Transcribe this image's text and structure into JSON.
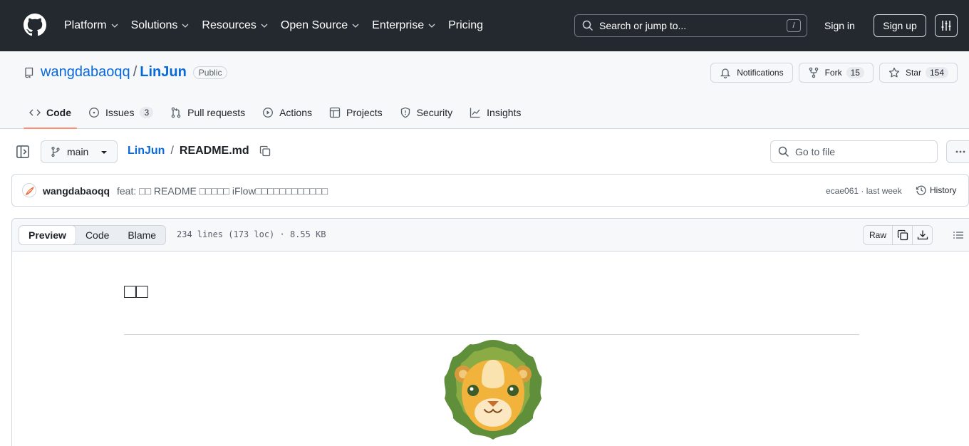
{
  "header": {
    "nav": [
      {
        "label": "Platform",
        "dropdown": true
      },
      {
        "label": "Solutions",
        "dropdown": true
      },
      {
        "label": "Resources",
        "dropdown": true
      },
      {
        "label": "Open Source",
        "dropdown": true
      },
      {
        "label": "Enterprise",
        "dropdown": true
      },
      {
        "label": "Pricing",
        "dropdown": false
      }
    ],
    "search_placeholder": "Search or jump to...",
    "search_shortcut": "/",
    "sign_in": "Sign in",
    "sign_up": "Sign up"
  },
  "repo": {
    "owner": "wangdabaoqq",
    "separator": "/",
    "name": "LinJun",
    "visibility": "Public",
    "notifications_label": "Notifications",
    "fork_label": "Fork",
    "fork_count": "15",
    "star_label": "Star",
    "star_count": "154",
    "tabs": [
      {
        "label": "Code",
        "active": true,
        "icon": "code-icon"
      },
      {
        "label": "Issues",
        "count": "3",
        "icon": "issue-icon"
      },
      {
        "label": "Pull requests",
        "icon": "pull-request-icon"
      },
      {
        "label": "Actions",
        "icon": "play-icon"
      },
      {
        "label": "Projects",
        "icon": "table-icon"
      },
      {
        "label": "Security",
        "icon": "shield-icon"
      },
      {
        "label": "Insights",
        "icon": "graph-icon"
      }
    ]
  },
  "file_nav": {
    "branch": "main",
    "crumb_repo": "LinJun",
    "crumb_sep": "/",
    "crumb_file": "README.md",
    "goto_placeholder": "Go to file"
  },
  "commit": {
    "author": "wangdabaoqq",
    "message": "feat: □□ README □□□□□ iFlow□□□□□□□□□□□□",
    "sha_time": "ecae061 · last week",
    "history_label": "History"
  },
  "file": {
    "tabs": [
      "Preview",
      "Code",
      "Blame"
    ],
    "active_tab": "Preview",
    "info": "234 lines (173 loc) · 8.55 KB",
    "raw_label": "Raw"
  },
  "readme": {
    "heading": "□□"
  },
  "colors": {
    "header_bg": "#24292f",
    "link": "#0969da",
    "active_tab_underline": "#fd8c73"
  }
}
